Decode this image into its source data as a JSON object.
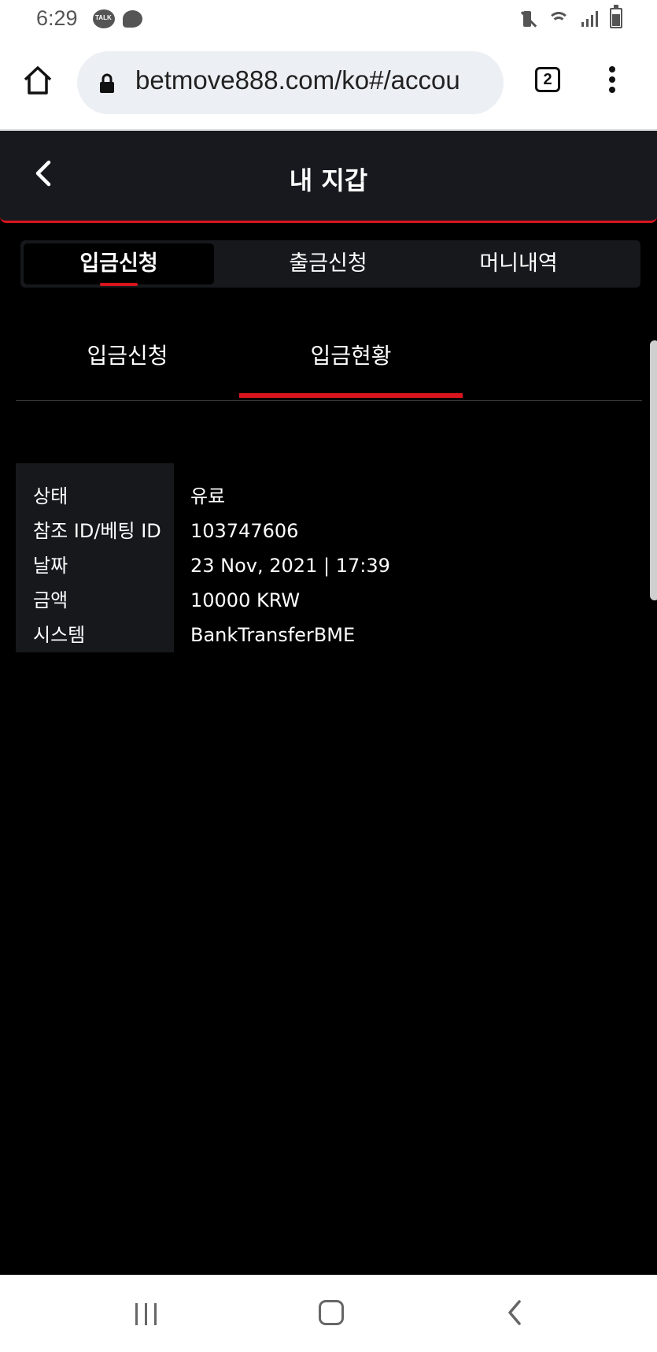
{
  "status_bar": {
    "time": "6:29",
    "talk_badge": "TALK",
    "icons": [
      "talk-icon",
      "chat-icon",
      "vibrate-icon",
      "wifi-icon",
      "signal-icon",
      "battery-icon"
    ]
  },
  "browser": {
    "url": "betmove888.com/ko#/accou",
    "tab_count": "2",
    "icons": [
      "home-icon",
      "lock-icon",
      "overflow-menu-icon"
    ]
  },
  "header": {
    "title": "내 지갑"
  },
  "main_tabs": [
    {
      "label": "입금신청",
      "active": true
    },
    {
      "label": "출금신청",
      "active": false
    },
    {
      "label": "머니내역",
      "active": false
    }
  ],
  "sub_tabs": [
    {
      "label": "입금신청",
      "active": false
    },
    {
      "label": "입금현황",
      "active": true
    }
  ],
  "detail": {
    "rows": [
      {
        "label": "상태",
        "value": "유료"
      },
      {
        "label": "참조 ID/베팅 ID",
        "value": "103747606"
      },
      {
        "label": "날짜",
        "value": "23 Nov, 2021 | 17:39"
      },
      {
        "label": "금액",
        "value": "10000 KRW"
      },
      {
        "label": "시스템",
        "value": "BankTransferBME"
      }
    ]
  },
  "colors": {
    "accent": "#d8141c",
    "header_bg": "#18191e",
    "page_bg": "#000000"
  }
}
